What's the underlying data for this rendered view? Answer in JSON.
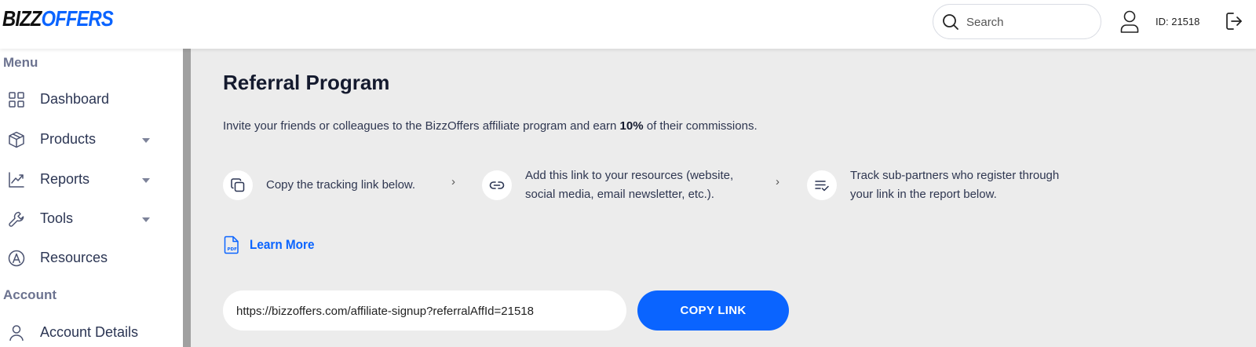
{
  "header": {
    "logo_part1": "BIZZ",
    "logo_part2": "OFFERS",
    "search_placeholder": "Search",
    "user_id": "ID: 21518"
  },
  "sidebar": {
    "menu_heading": "Menu",
    "items": [
      {
        "label": "Dashboard",
        "icon": "dashboard-grid-icon"
      },
      {
        "label": "Products",
        "icon": "box-icon",
        "has_dropdown": true
      },
      {
        "label": "Reports",
        "icon": "chart-line-icon",
        "has_dropdown": true
      },
      {
        "label": "Tools",
        "icon": "wrench-icon",
        "has_dropdown": true
      },
      {
        "label": "Resources",
        "icon": "resources-icon"
      }
    ],
    "account_heading": "Account",
    "account_items": [
      {
        "label": "Account Details",
        "icon": "user-icon"
      }
    ]
  },
  "main": {
    "title": "Referral Program",
    "intro_before": "Invite your friends or colleagues to the BizzOffers affiliate program and earn ",
    "intro_bold": "10%",
    "intro_after": " of their commissions.",
    "steps": [
      {
        "line1": "Copy the tracking link below.",
        "line2": "",
        "icon": "copy-icon"
      },
      {
        "line1": "Add this link to your resources (website,",
        "line2": "social media, email newsletter, etc.).",
        "icon": "link-icon"
      },
      {
        "line1": "Track sub-partners who register through",
        "line2": "your link in the report below.",
        "icon": "list-check-icon"
      }
    ],
    "learn_more": "Learn More",
    "referral_link": "https://bizzoffers.com/affiliate-signup?referralAffId=21518",
    "copy_button": "COPY LINK"
  },
  "colors": {
    "accent": "#0a64ff",
    "background": "#ececec",
    "sidebar_border": "#a0a0a0"
  }
}
